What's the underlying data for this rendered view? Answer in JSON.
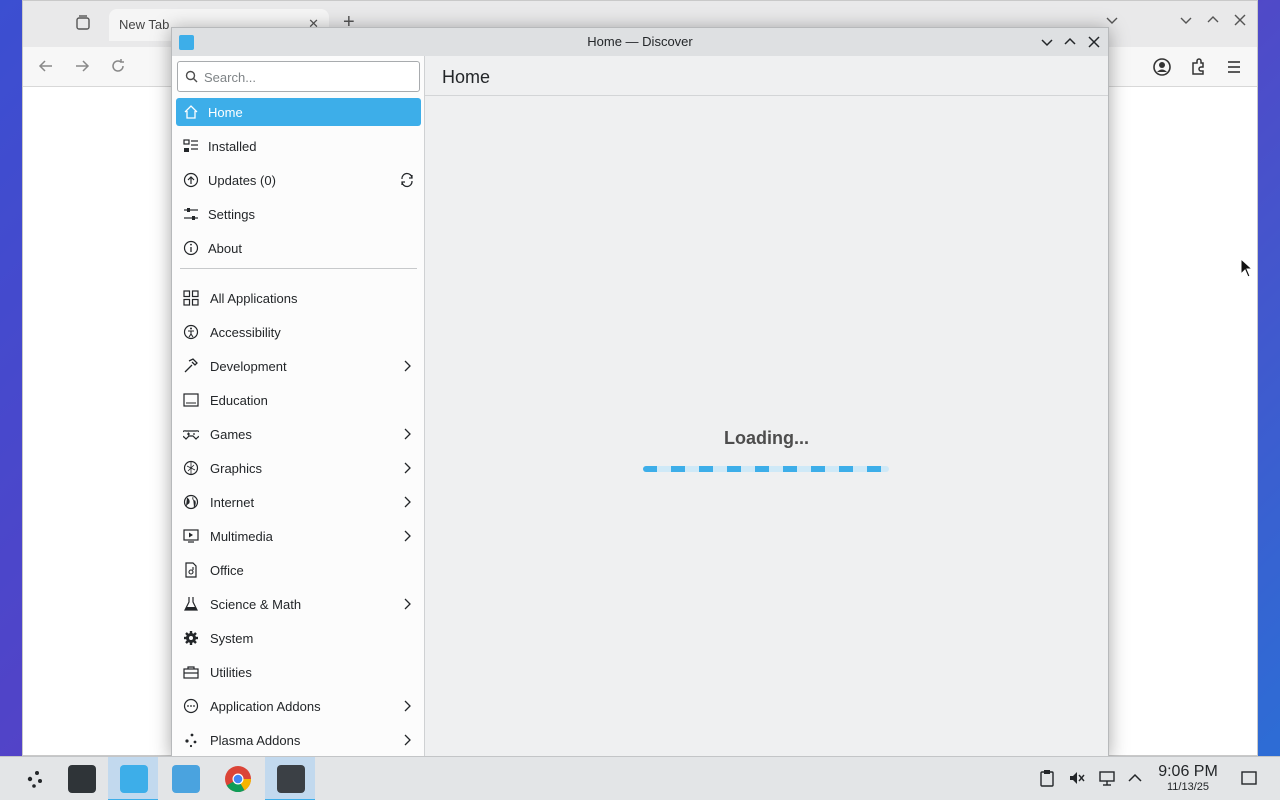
{
  "browser": {
    "tab_title": "New Tab",
    "tab_close": "✕",
    "new_tab": "+"
  },
  "window": {
    "title": "Home — Discover"
  },
  "search": {
    "placeholder": "Search...",
    "value": ""
  },
  "main": {
    "header": "Home",
    "loading_text": "Loading...",
    "loading_progress": 1.0
  },
  "nav": [
    {
      "label": "Home",
      "icon": "home-icon",
      "active": true
    },
    {
      "label": "Installed",
      "icon": "installed-icon"
    },
    {
      "label": "Updates (0)",
      "icon": "updates-icon",
      "extra_icon": "refresh-icon"
    },
    {
      "label": "Settings",
      "icon": "settings-icon"
    },
    {
      "label": "About",
      "icon": "about-icon"
    }
  ],
  "categories": [
    {
      "label": "All Applications",
      "icon": "grid-icon",
      "submenu": false
    },
    {
      "label": "Accessibility",
      "icon": "accessibility-icon",
      "submenu": false
    },
    {
      "label": "Development",
      "icon": "hammer-icon",
      "submenu": true
    },
    {
      "label": "Education",
      "icon": "education-icon",
      "submenu": false
    },
    {
      "label": "Games",
      "icon": "gamepad-icon",
      "submenu": true
    },
    {
      "label": "Graphics",
      "icon": "graphics-icon",
      "submenu": true
    },
    {
      "label": "Internet",
      "icon": "globe-icon",
      "submenu": true
    },
    {
      "label": "Multimedia",
      "icon": "multimedia-icon",
      "submenu": true
    },
    {
      "label": "Office",
      "icon": "office-icon",
      "submenu": false
    },
    {
      "label": "Science & Math",
      "icon": "flask-icon",
      "submenu": true
    },
    {
      "label": "System",
      "icon": "gear-icon",
      "submenu": false
    },
    {
      "label": "Utilities",
      "icon": "toolbox-icon",
      "submenu": false
    },
    {
      "label": "Application Addons",
      "icon": "addons-icon",
      "submenu": true
    },
    {
      "label": "Plasma Addons",
      "icon": "plasma-icon",
      "submenu": true
    }
  ],
  "taskbar": {
    "time": "9:06 PM",
    "date": "11/13/25"
  },
  "colors": {
    "accent": "#3daee9"
  }
}
